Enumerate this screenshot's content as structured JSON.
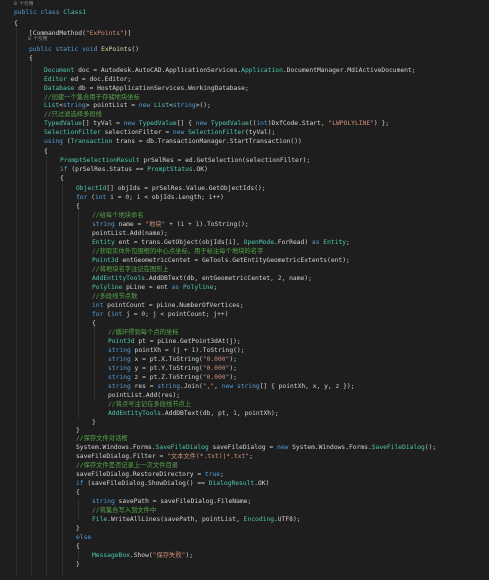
{
  "editor": {
    "references_top": "0 个引用",
    "references_method": "0 个引用",
    "lines": [
      [
        [
          "kw",
          "public "
        ],
        [
          "kw",
          "class "
        ],
        [
          "ty",
          "Class1"
        ]
      ],
      [
        [
          "br",
          "{"
        ]
      ],
      [
        [
          "pl",
          "[CommandMethod("
        ],
        [
          "st",
          "\"ExPoints\""
        ],
        [
          "pl",
          ")]"
        ]
      ],
      [
        [
          "kw",
          "public "
        ],
        [
          "kw",
          "static "
        ],
        [
          "kw",
          "void "
        ],
        [
          "mt",
          "ExPoints"
        ],
        [
          "pl",
          "()"
        ]
      ],
      [
        [
          "br",
          "{"
        ]
      ],
      [
        [
          "ty",
          "Document"
        ],
        [
          "pl",
          " doc = Autodesk.AutoCAD.ApplicationServices."
        ],
        [
          "ty",
          "Application"
        ],
        [
          "pl",
          ".DocumentManager.MdiActiveDocument;"
        ]
      ],
      [
        [
          "ty",
          "Editor"
        ],
        [
          "pl",
          " ed = doc.Editor;"
        ]
      ],
      [
        [
          "ty",
          "Database"
        ],
        [
          "pl",
          " db = HostApplicationServices.WorkingDatabase;"
        ]
      ],
      [
        [
          "cm",
          "//创建一个集合用于存储地块坐标"
        ]
      ],
      [
        [
          "ty",
          "List"
        ],
        [
          "pl",
          "<"
        ],
        [
          "kw",
          "string"
        ],
        [
          "pl",
          "> pointList = "
        ],
        [
          "kw",
          "new "
        ],
        [
          "ty",
          "List"
        ],
        [
          "pl",
          "<"
        ],
        [
          "kw",
          "string"
        ],
        [
          "pl",
          ">();"
        ]
      ],
      [
        [
          "cm",
          "//只过滤选择多段线"
        ]
      ],
      [
        [
          "ty",
          "TypedValue"
        ],
        [
          "pl",
          "[] tyVal = "
        ],
        [
          "kw",
          "new "
        ],
        [
          "ty",
          "TypedValue"
        ],
        [
          "pl",
          "[] { "
        ],
        [
          "kw",
          "new "
        ],
        [
          "ty",
          "TypedValue"
        ],
        [
          "pl",
          "(("
        ],
        [
          "kw",
          "int"
        ],
        [
          "pl",
          ")DxfCode.Start, "
        ],
        [
          "st",
          "\"LWPOLYLINE\""
        ],
        [
          "pl",
          ") };"
        ]
      ],
      [
        [
          "ty",
          "SelectionFilter"
        ],
        [
          "pl",
          " selectionFilter = "
        ],
        [
          "kw",
          "new "
        ],
        [
          "ty",
          "SelectionFilter"
        ],
        [
          "pl",
          "(tyVal);"
        ]
      ],
      [
        [
          "kw",
          "using "
        ],
        [
          "pl",
          "("
        ],
        [
          "ty",
          "Transaction"
        ],
        [
          "pl",
          " trans = db.TransactionManager.StartTransaction())"
        ]
      ],
      [
        [
          "br",
          "{"
        ]
      ],
      [
        [
          "ty",
          "PromptSelectionResult"
        ],
        [
          "pl",
          " prSelRes = ed.GetSelection(selectionFilter);"
        ]
      ],
      [
        [
          "kw",
          "if "
        ],
        [
          "pl",
          "(prSelRes.Status == "
        ],
        [
          "ty",
          "PromptStatus"
        ],
        [
          "pl",
          ".OK)"
        ]
      ],
      [
        [
          "br",
          "{"
        ]
      ],
      [
        [
          "ty",
          "ObjectId"
        ],
        [
          "pl",
          "[] objIds = prSelRes.Value.GetObjectIds();"
        ]
      ],
      [
        [
          "kw",
          "for "
        ],
        [
          "pl",
          "("
        ],
        [
          "kw",
          "int"
        ],
        [
          "pl",
          " i = "
        ],
        [
          "nm",
          "0"
        ],
        [
          "pl",
          "; i < objIds.Length; i++)"
        ]
      ],
      [
        [
          "br",
          "{"
        ]
      ],
      [
        [
          "cm",
          "//给每个地块命名"
        ]
      ],
      [
        [
          "kw",
          "string"
        ],
        [
          "pl",
          " name = "
        ],
        [
          "st",
          "\"地块\""
        ],
        [
          "pl",
          " + (i + "
        ],
        [
          "nm",
          "1"
        ],
        [
          "pl",
          ").ToString();"
        ]
      ],
      [
        [
          "pl",
          "pointList.Add(name);"
        ]
      ],
      [
        [
          "ty",
          "Entity"
        ],
        [
          "pl",
          " ent = trans.GetObject(objIds[i], "
        ],
        [
          "ty",
          "OpenMode"
        ],
        [
          "pl",
          ".ForRead) "
        ],
        [
          "kw",
          "as "
        ],
        [
          "ty",
          "Entity"
        ],
        [
          "pl",
          ";"
        ]
      ],
      [
        [
          "cm",
          "//获取实体外包围框的中心点坐标，用于标注每个地块的名字"
        ]
      ],
      [
        [
          "ty",
          "Point3d"
        ],
        [
          "pl",
          " entGeometricCentet = GeTools.GetEntityGeometricExtents(ent);"
        ]
      ],
      [
        [
          "cm",
          "//将地块名字注记在图形上"
        ]
      ],
      [
        [
          "ty",
          "AddEntityTools"
        ],
        [
          "pl",
          ".AddDBText(db, entGeometricCentet, "
        ],
        [
          "nm",
          "2"
        ],
        [
          "pl",
          ", name);"
        ]
      ],
      [
        [
          "ty",
          "Polyline"
        ],
        [
          "pl",
          " pLine = ent "
        ],
        [
          "kw",
          "as "
        ],
        [
          "ty",
          "Polyline"
        ],
        [
          "pl",
          ";"
        ]
      ],
      [
        [
          "cm",
          "//多段线节点数"
        ]
      ],
      [
        [
          "kw",
          "int"
        ],
        [
          "pl",
          " pointCount = pLine.NumberOfVertices;"
        ]
      ],
      [
        [
          "kw",
          "for "
        ],
        [
          "pl",
          "("
        ],
        [
          "kw",
          "int"
        ],
        [
          "pl",
          " j = "
        ],
        [
          "nm",
          "0"
        ],
        [
          "pl",
          "; j < pointCount; j++)"
        ]
      ],
      [
        [
          "br",
          "{"
        ]
      ],
      [
        [
          "cm",
          "//循环得到每个点的坐标"
        ]
      ],
      [
        [
          "ty",
          "Point3d"
        ],
        [
          "pl",
          " pt = pLine.GetPoint3dAt(j);"
        ]
      ],
      [
        [
          "kw",
          "string"
        ],
        [
          "pl",
          " pointXh = (j + "
        ],
        [
          "nm",
          "1"
        ],
        [
          "pl",
          ").ToString();"
        ]
      ],
      [
        [
          "kw",
          "string"
        ],
        [
          "pl",
          " x = pt.X.ToString("
        ],
        [
          "st",
          "\"0.000\""
        ],
        [
          "pl",
          ");"
        ]
      ],
      [
        [
          "kw",
          "string"
        ],
        [
          "pl",
          " y = pt.Y.ToString("
        ],
        [
          "st",
          "\"0.000\""
        ],
        [
          "pl",
          ");"
        ]
      ],
      [
        [
          "kw",
          "string"
        ],
        [
          "pl",
          " z = pt.Z.ToString("
        ],
        [
          "st",
          "\"0.000\""
        ],
        [
          "pl",
          ");"
        ]
      ],
      [
        [
          "kw",
          "string"
        ],
        [
          "pl",
          " res = "
        ],
        [
          "kw",
          "string"
        ],
        [
          "pl",
          ".Join("
        ],
        [
          "st",
          "\",\""
        ],
        [
          "pl",
          ", "
        ],
        [
          "kw",
          "new "
        ],
        [
          "kw",
          "string"
        ],
        [
          "pl",
          "[] { pointXh, x, y, z });"
        ]
      ],
      [
        [
          "pl",
          "pointList.Add(res);"
        ]
      ],
      [
        [
          "cm",
          "//将点号注记在多段线节点上"
        ]
      ],
      [
        [
          "ty",
          "AddEntityTools"
        ],
        [
          "pl",
          ".AddDBText(db, pt, "
        ],
        [
          "nm",
          "1"
        ],
        [
          "pl",
          ", pointXh);"
        ]
      ],
      [
        [
          "br",
          "}"
        ]
      ],
      [
        [
          "br",
          "}"
        ]
      ],
      [
        [
          "cm",
          "//保存文件对话框"
        ]
      ],
      [
        [
          "pl",
          "System.Windows.Forms."
        ],
        [
          "ty",
          "SaveFileDialog"
        ],
        [
          "pl",
          " saveFileDialog = "
        ],
        [
          "kw",
          "new "
        ],
        [
          "pl",
          "System.Windows.Forms."
        ],
        [
          "ty",
          "SaveFileDialog"
        ],
        [
          "pl",
          "();"
        ]
      ],
      [
        [
          "pl",
          "saveFileDialog.Filter = "
        ],
        [
          "st",
          "\"文本文件(*.txt)|*.txt\""
        ],
        [
          "pl",
          ";"
        ]
      ],
      [
        [
          "cm",
          "//保存文件是否记录上一次文件目录"
        ]
      ],
      [
        [
          "pl",
          "saveFileDialog.RestoreDirectory = "
        ],
        [
          "kw",
          "true"
        ],
        [
          "pl",
          ";"
        ]
      ],
      [
        [
          "kw",
          "if "
        ],
        [
          "pl",
          "(saveFileDialog.ShowDialog() == "
        ],
        [
          "ty",
          "DialogResult"
        ],
        [
          "pl",
          ".OK)"
        ]
      ],
      [
        [
          "br",
          "{"
        ]
      ],
      [
        [
          "kw",
          "string"
        ],
        [
          "pl",
          " savePath = saveFileDialog.FileName;"
        ]
      ],
      [
        [
          "cm",
          "//将集合写入到文件中"
        ]
      ],
      [
        [
          "ty",
          "File"
        ],
        [
          "pl",
          ".WriteAllLines(savePath, pointList, "
        ],
        [
          "ty",
          "Encoding"
        ],
        [
          "pl",
          ".UTF8);"
        ]
      ],
      [
        [
          "br",
          "}"
        ]
      ],
      [
        [
          "kw",
          "else"
        ]
      ],
      [
        [
          "br",
          "{"
        ]
      ],
      [
        [
          "ty",
          "MessageBox"
        ],
        [
          "pl",
          ".Show("
        ],
        [
          "st",
          "\"保存失败\""
        ],
        [
          "pl",
          ");"
        ]
      ],
      [
        [
          "br",
          "}"
        ]
      ]
    ]
  }
}
